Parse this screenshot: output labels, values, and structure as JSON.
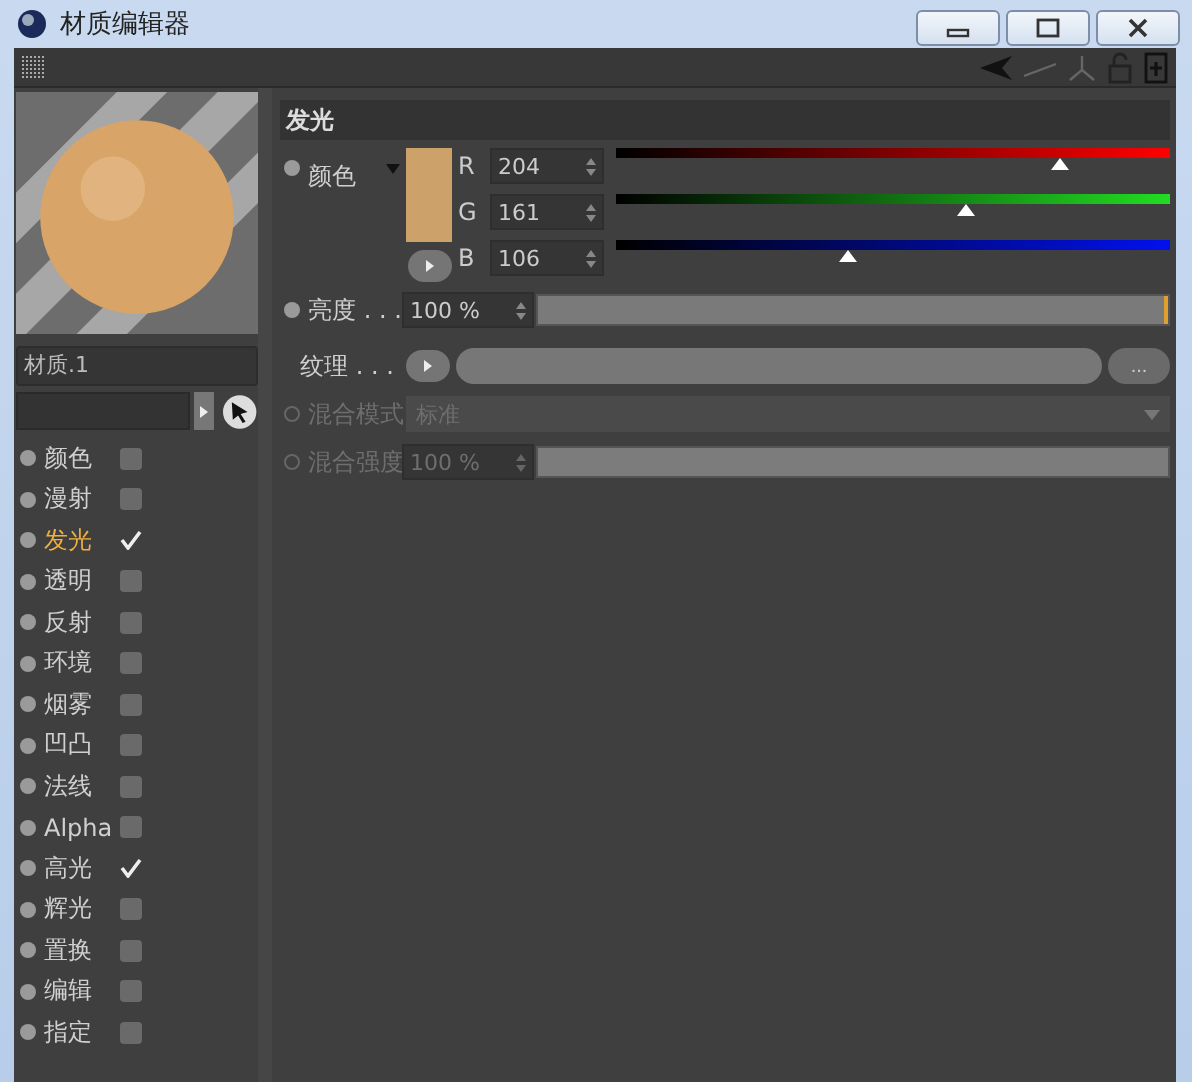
{
  "window": {
    "title": "材质编辑器"
  },
  "material": {
    "name": "材质.1"
  },
  "channels": [
    {
      "name": "颜色",
      "checked": false,
      "selected": false
    },
    {
      "name": "漫射",
      "checked": false,
      "selected": false
    },
    {
      "name": "发光",
      "checked": true,
      "selected": true
    },
    {
      "name": "透明",
      "checked": false,
      "selected": false
    },
    {
      "name": "反射",
      "checked": false,
      "selected": false
    },
    {
      "name": "环境",
      "checked": false,
      "selected": false
    },
    {
      "name": "烟雾",
      "checked": false,
      "selected": false
    },
    {
      "name": "凹凸",
      "checked": false,
      "selected": false
    },
    {
      "name": "法线",
      "checked": false,
      "selected": false
    },
    {
      "name": "Alpha",
      "checked": false,
      "selected": false
    },
    {
      "name": "高光",
      "checked": true,
      "selected": false
    },
    {
      "name": "辉光",
      "checked": false,
      "selected": false
    },
    {
      "name": "置换",
      "checked": false,
      "selected": false
    },
    {
      "name": "编辑",
      "checked": false,
      "selected": false
    },
    {
      "name": "指定",
      "checked": false,
      "selected": false
    }
  ],
  "panel": {
    "title": "发光",
    "color": {
      "label": "颜色",
      "components": [
        {
          "letter": "R",
          "value": "204",
          "level": 0.8
        },
        {
          "letter": "G",
          "value": "161",
          "level": 0.63
        },
        {
          "letter": "B",
          "value": "106",
          "level": 0.42
        }
      ]
    },
    "brightness": {
      "label": "亮度 . . .",
      "value": "100 %",
      "level": 1,
      "disabled": false
    },
    "texture": {
      "label": "纹理 . . .",
      "more": "..."
    },
    "blend_mode": {
      "label": "混合模式",
      "value": "标准",
      "disabled": true
    },
    "blend_strength": {
      "label": "混合强度",
      "value": "100 %",
      "level": 1,
      "disabled": true
    }
  }
}
